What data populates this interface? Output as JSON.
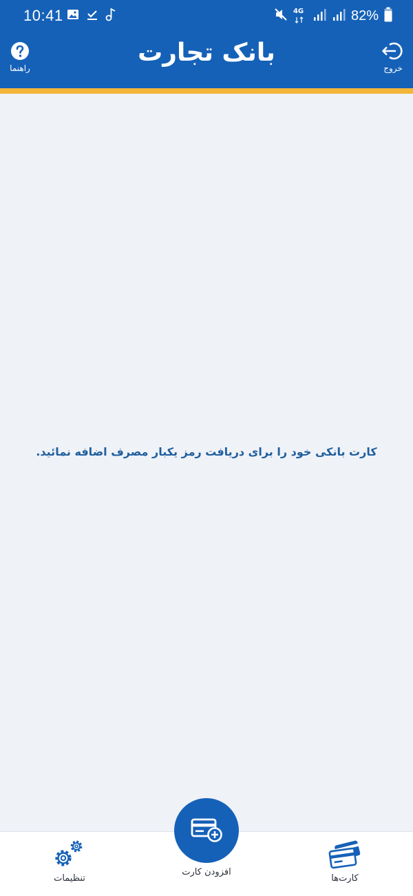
{
  "status_bar": {
    "time": "10:41",
    "network": "4G",
    "battery": "82%",
    "icons": [
      "image-icon",
      "check-icon",
      "music-note-icon",
      "mute-icon",
      "signal-icon",
      "signal-icon",
      "battery-icon"
    ]
  },
  "header": {
    "logo": "بانک تجارت",
    "help_label": "راهنما",
    "logout_label": "خروج"
  },
  "main": {
    "message": "کارت بانکی خود را برای دریافت رمز یکبار مصرف اضافه نمائید."
  },
  "bottom_nav": {
    "cards_label": "کارت‌ها",
    "add_card_label": "افزودن کارت",
    "settings_label": "تنظیمات"
  },
  "colors": {
    "primary": "#1561b8",
    "accent": "#f3b53a",
    "background": "#eff2f7",
    "message_text": "#1f5e9e"
  }
}
